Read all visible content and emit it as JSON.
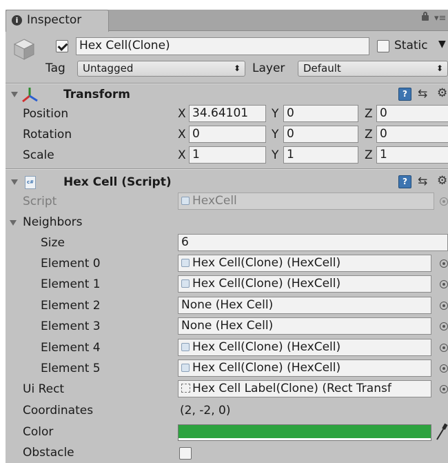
{
  "inspector": {
    "tab_title": "Inspector",
    "header": {
      "active": true,
      "object_name": "Hex Cell(Clone)",
      "static_label": "Static",
      "static_checked": false,
      "tag_label": "Tag",
      "tag_value": "Untagged",
      "layer_label": "Layer",
      "layer_value": "Default"
    },
    "transform": {
      "title": "Transform",
      "rows": [
        {
          "label": "Position",
          "x": "34.64101",
          "y": "0",
          "z": "0"
        },
        {
          "label": "Rotation",
          "x": "0",
          "y": "0",
          "z": "0"
        },
        {
          "label": "Scale",
          "x": "1",
          "y": "1",
          "z": "1"
        }
      ],
      "axis_x": "X",
      "axis_y": "Y",
      "axis_z": "Z"
    },
    "hexcell": {
      "title": "Hex Cell (Script)",
      "script_label": "Script",
      "script_value": "HexCell",
      "neighbors_label": "Neighbors",
      "size_label": "Size",
      "size_value": "6",
      "elements": [
        {
          "label": "Element 0",
          "value": "Hex Cell(Clone) (HexCell)",
          "has_ref": true
        },
        {
          "label": "Element 1",
          "value": "Hex Cell(Clone) (HexCell)",
          "has_ref": true
        },
        {
          "label": "Element 2",
          "value": "None (Hex Cell)",
          "has_ref": false
        },
        {
          "label": "Element 3",
          "value": "None (Hex Cell)",
          "has_ref": false
        },
        {
          "label": "Element 4",
          "value": "Hex Cell(Clone) (HexCell)",
          "has_ref": true
        },
        {
          "label": "Element 5",
          "value": "Hex Cell(Clone) (HexCell)",
          "has_ref": true
        }
      ],
      "ui_rect_label": "Ui Rect",
      "ui_rect_value": "Hex Cell Label(Clone) (Rect Transf",
      "coordinates_label": "Coordinates",
      "coordinates_value": "(2, -2, 0)",
      "color_label": "Color",
      "color_value": "#2da33f",
      "obstacle_label": "Obstacle",
      "obstacle_checked": false
    }
  }
}
